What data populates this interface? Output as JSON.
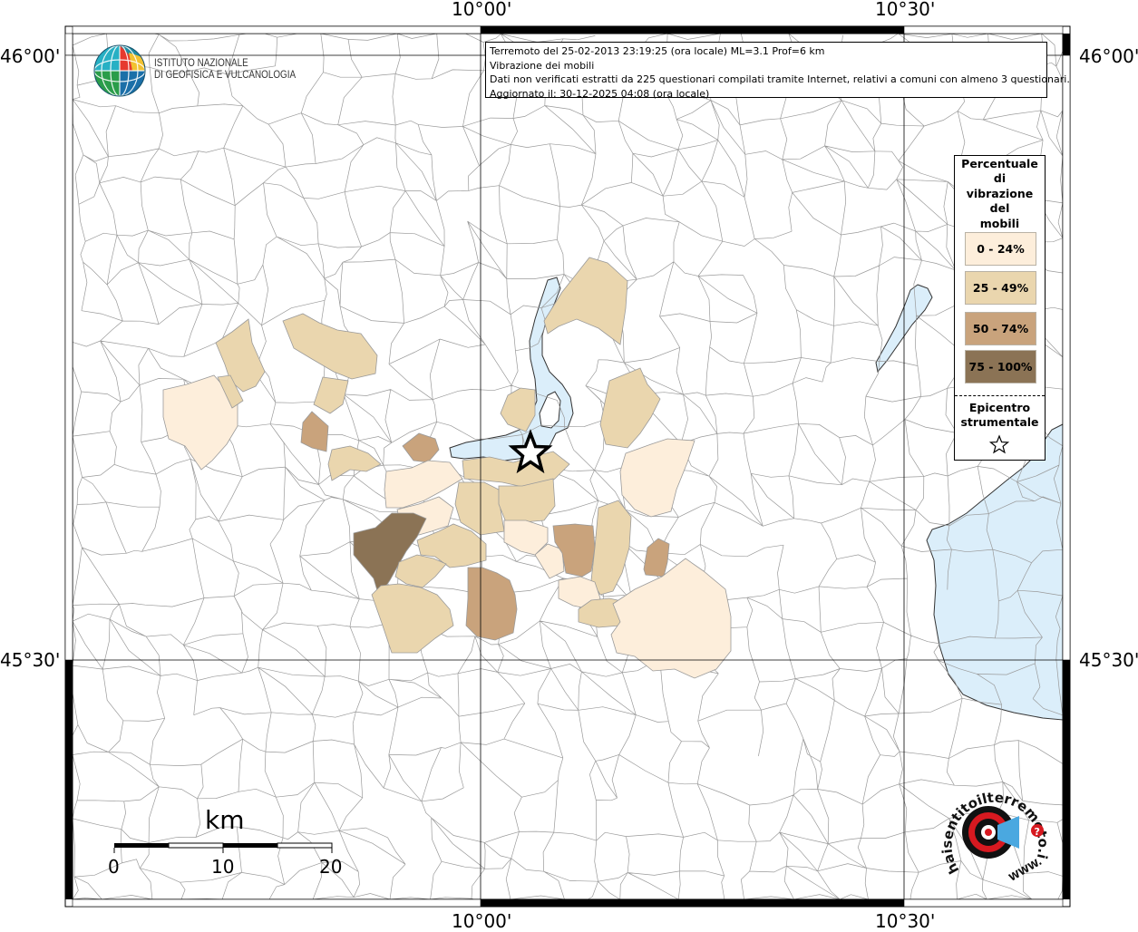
{
  "map": {
    "lon_labels": [
      "10°00'",
      "10°30'"
    ],
    "lat_labels": [
      "46°00'",
      "45°30'"
    ],
    "lon_range": [
      9.7,
      10.85
    ],
    "lat_range": [
      45.26,
      46.03
    ]
  },
  "info": {
    "line1": "Terremoto del 25-02-2013 23:19:25 (ora locale) ML=3.1 Prof=6 km",
    "line2": "Vibrazione dei mobili",
    "line3": "Dati non verificati estratti da 225 questionari compilati tramite Internet, relativi a comuni con almeno 3 questionari.",
    "line4": "Aggiornato il: 30-12-2025 04:08 (ora locale)"
  },
  "legend": {
    "title_lines": [
      "Percentuale",
      "di",
      "vibrazione",
      "del",
      "mobili"
    ],
    "classes": [
      {
        "label": "0 - 24%",
        "color": "#fdeedb"
      },
      {
        "label": "25 - 49%",
        "color": "#ead6ae"
      },
      {
        "label": "50 - 74%",
        "color": "#c9a37c"
      },
      {
        "label": "75 - 100%",
        "color": "#8b7355"
      }
    ],
    "epicenter_lines": [
      "Epicentro",
      "strumentale"
    ]
  },
  "logos": {
    "ingv_line1": "ISTITUTO NAZIONALE",
    "ingv_line2": "DI GEOFISICA E VULCANOLOGIA",
    "hst_text": "haisentitoilterremoto.it",
    "hst_www": "WWW.",
    "hst_q": "?"
  },
  "scale": {
    "unit": "km",
    "ticks": [
      "0",
      "10",
      "20"
    ]
  },
  "colors": {
    "water": "#dbeefa",
    "border": "#9a9a9a",
    "frame": "#000000"
  }
}
